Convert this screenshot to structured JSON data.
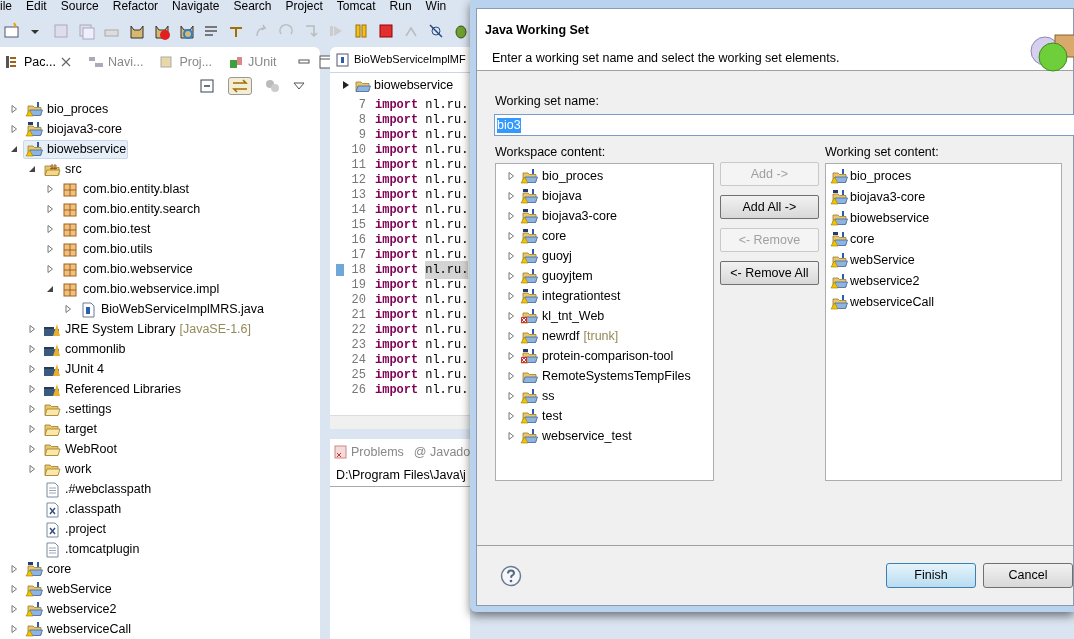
{
  "menu": [
    "ile",
    "Edit",
    "Source",
    "Refactor",
    "Navigate",
    "Search",
    "Project",
    "Tomcat",
    "Run",
    "Win"
  ],
  "view_tabs": [
    {
      "label": "Pac...",
      "selected": true
    },
    {
      "label": "Navi...",
      "selected": false
    },
    {
      "label": "Proj...",
      "selected": false
    },
    {
      "label": "JUnit",
      "selected": false
    }
  ],
  "package_explorer": {
    "tree": [
      {
        "label": "bio_proces",
        "kind": "java_project",
        "expanded": false,
        "selected": false
      },
      {
        "label": "biojava3-core",
        "kind": "maven_project",
        "expanded": false,
        "selected": false
      },
      {
        "label": "biowebservice",
        "kind": "java_project",
        "expanded": true,
        "selected": true,
        "children": [
          {
            "label": "src",
            "kind": "source_folder",
            "expanded": true,
            "selected": false,
            "children": [
              {
                "label": "com.bio.entity.blast",
                "kind": "package",
                "expanded": false,
                "selected": false
              },
              {
                "label": "com.bio.entity.search",
                "kind": "package",
                "expanded": false,
                "selected": false
              },
              {
                "label": "com.bio.test",
                "kind": "package",
                "expanded": false,
                "selected": false
              },
              {
                "label": "com.bio.utils",
                "kind": "package",
                "expanded": false,
                "selected": false
              },
              {
                "label": "com.bio.webservice",
                "kind": "package",
                "expanded": false,
                "selected": false
              },
              {
                "label": "com.bio.webservice.impl",
                "kind": "package",
                "expanded": true,
                "selected": false,
                "children": [
                  {
                    "label": "BioWebServiceImplMRS.java",
                    "kind": "java_file",
                    "expanded": false,
                    "selected": false
                  }
                ]
              }
            ]
          },
          {
            "label": "JRE System Library",
            "decoration": "[JavaSE-1.6]",
            "kind": "library",
            "expanded": false,
            "selected": false
          },
          {
            "label": "commonlib",
            "kind": "library",
            "expanded": false,
            "selected": false
          },
          {
            "label": "JUnit 4",
            "kind": "library",
            "expanded": false,
            "selected": false
          },
          {
            "label": "Referenced Libraries",
            "kind": "library",
            "expanded": false,
            "selected": false
          },
          {
            "label": ".settings",
            "kind": "folder",
            "expanded": false,
            "selected": false
          },
          {
            "label": "target",
            "kind": "folder",
            "expanded": false,
            "selected": false
          },
          {
            "label": "WebRoot",
            "kind": "folder",
            "expanded": false,
            "selected": false
          },
          {
            "label": "work",
            "kind": "folder",
            "expanded": false,
            "selected": false
          },
          {
            "label": ".#webclasspath",
            "kind": "file",
            "selected": false
          },
          {
            "label": ".classpath",
            "kind": "xml_file",
            "selected": false
          },
          {
            "label": ".project",
            "kind": "xml_file",
            "selected": false
          },
          {
            "label": ".tomcatplugin",
            "kind": "file",
            "selected": false
          }
        ]
      },
      {
        "label": "core",
        "kind": "maven_project",
        "expanded": false,
        "selected": false
      },
      {
        "label": "webService",
        "kind": "java_project",
        "expanded": false,
        "selected": false
      },
      {
        "label": "webservice2",
        "kind": "java_project",
        "expanded": false,
        "selected": false
      },
      {
        "label": "webserviceCall",
        "kind": "java_project",
        "expanded": false,
        "selected": false
      }
    ]
  },
  "editor": {
    "tab": "BioWebServiceImplMF",
    "breadcrumb": "biowebservice",
    "lines": [
      {
        "number": "7",
        "keyword": "import",
        "text": "nl.ru.",
        "highlighted": false
      },
      {
        "number": "8",
        "keyword": "import",
        "text": "nl.ru.",
        "highlighted": false
      },
      {
        "number": "9",
        "keyword": "import",
        "text": "nl.ru.",
        "highlighted": false
      },
      {
        "number": "10",
        "keyword": "import",
        "text": "nl.ru.",
        "highlighted": false
      },
      {
        "number": "11",
        "keyword": "import",
        "text": "nl.ru.",
        "highlighted": false
      },
      {
        "number": "12",
        "keyword": "import",
        "text": "nl.ru.",
        "highlighted": false
      },
      {
        "number": "13",
        "keyword": "import",
        "text": "nl.ru.",
        "highlighted": false
      },
      {
        "number": "14",
        "keyword": "import",
        "text": "nl.ru.",
        "highlighted": false
      },
      {
        "number": "15",
        "keyword": "import",
        "text": "nl.ru.",
        "highlighted": false
      },
      {
        "number": "16",
        "keyword": "import",
        "text": "nl.ru.",
        "highlighted": false
      },
      {
        "number": "17",
        "keyword": "import",
        "text": "nl.ru.",
        "highlighted": false
      },
      {
        "number": "18",
        "keyword": "import",
        "text": "nl.ru.",
        "highlighted": true
      },
      {
        "number": "19",
        "keyword": "import",
        "text": "nl.ru.",
        "highlighted": false
      },
      {
        "number": "20",
        "keyword": "import",
        "text": "nl.ru.",
        "highlighted": false
      },
      {
        "number": "21",
        "keyword": "import",
        "text": "nl.ru.",
        "highlighted": false
      },
      {
        "number": "22",
        "keyword": "import",
        "text": "nl.ru.",
        "highlighted": false
      },
      {
        "number": "23",
        "keyword": "import",
        "text": "nl.ru.",
        "highlighted": false
      },
      {
        "number": "24",
        "keyword": "import",
        "text": "nl.ru.",
        "highlighted": false
      },
      {
        "number": "25",
        "keyword": "import",
        "text": "nl.ru.",
        "highlighted": false
      },
      {
        "number": "26",
        "keyword": "import",
        "text": "nl.ru.",
        "highlighted": false
      }
    ]
  },
  "bottom_panel": {
    "tabs": [
      {
        "label": "Problems",
        "selected": false
      },
      {
        "label": "@ Javado",
        "selected": false
      }
    ],
    "text": "D:\\Program Files\\Java\\j"
  },
  "dialog": {
    "title": "Java Working Set",
    "description": "Enter a working set name and select the working set elements.",
    "name_label": "Working set name:",
    "name_value": "bio3",
    "workspace_label": "Workspace content:",
    "working_set_label": "Working set content:",
    "workspace_items": [
      {
        "label": "bio_proces",
        "kind": "java_project",
        "error": false
      },
      {
        "label": "biojava",
        "kind": "maven_project",
        "error": false
      },
      {
        "label": "biojava3-core",
        "kind": "maven_project",
        "error": false
      },
      {
        "label": "core",
        "kind": "maven_project",
        "error": false
      },
      {
        "label": "guoyj",
        "kind": "java_project",
        "error": false
      },
      {
        "label": "guoyjtem",
        "kind": "java_project",
        "error": false
      },
      {
        "label": "integrationtest",
        "kind": "maven_project",
        "error": false
      },
      {
        "label": "kl_tnt_Web",
        "kind": "java_project",
        "error": true
      },
      {
        "label": "newrdf",
        "decoration": "[trunk]",
        "kind": "java_project",
        "error": false
      },
      {
        "label": "protein-comparison-tool",
        "kind": "maven_project",
        "error": true
      },
      {
        "label": "RemoteSystemsTempFiles",
        "kind": "folder_project",
        "error": false
      },
      {
        "label": "ss",
        "kind": "java_project",
        "error": false
      },
      {
        "label": "test",
        "kind": "java_project",
        "error": false
      },
      {
        "label": "webservice_test",
        "kind": "java_project",
        "error": false
      }
    ],
    "buttons": [
      {
        "label": "Add ->",
        "disabled": true
      },
      {
        "label": "Add All ->",
        "disabled": false
      },
      {
        "label": "<- Remove",
        "disabled": true
      },
      {
        "label": "<- Remove All",
        "disabled": false
      }
    ],
    "working_set_items": [
      {
        "label": "bio_proces",
        "kind": "java_project"
      },
      {
        "label": "biojava3-core",
        "kind": "maven_project"
      },
      {
        "label": "biowebservice",
        "kind": "java_project"
      },
      {
        "label": "core",
        "kind": "maven_project"
      },
      {
        "label": "webService",
        "kind": "java_project"
      },
      {
        "label": "webservice2",
        "kind": "java_project"
      },
      {
        "label": "webserviceCall",
        "kind": "java_project"
      }
    ],
    "footer_buttons": [
      {
        "label": "Finish",
        "default": true
      },
      {
        "label": "Cancel",
        "default": false
      }
    ]
  }
}
